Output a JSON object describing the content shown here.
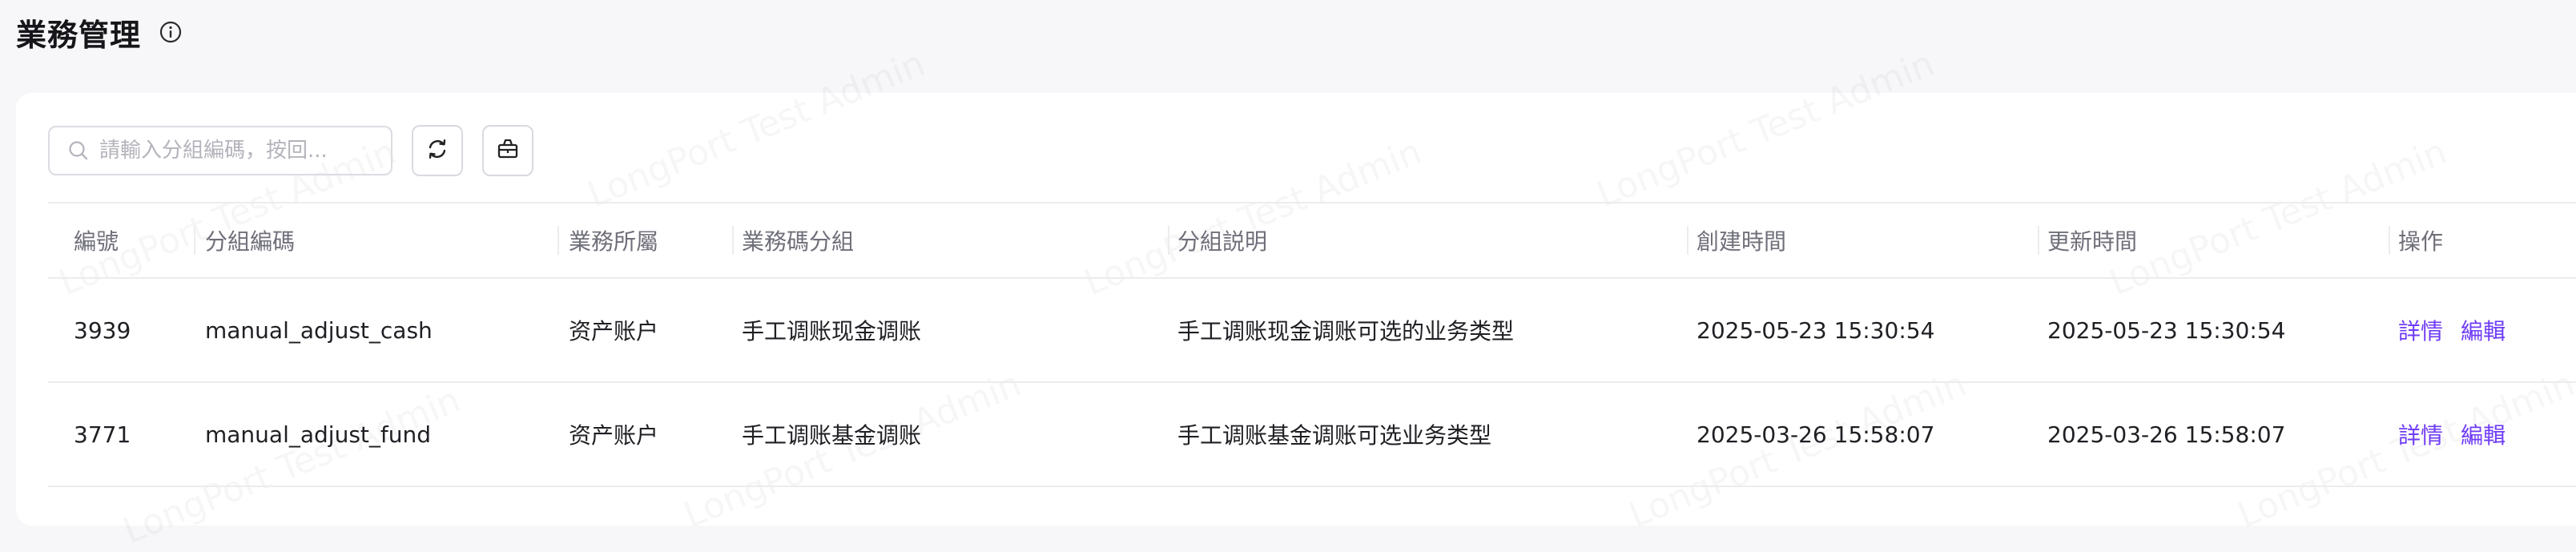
{
  "page": {
    "title": "業務管理"
  },
  "toolbar": {
    "search_placeholder": "請輸入分組編碼，按回...",
    "refresh_icon": "refresh-icon",
    "basket_icon": "basket-icon"
  },
  "table": {
    "headers": [
      "編號",
      "分組編碼",
      "業務所屬",
      "業務碼分組",
      "分組説明",
      "創建時間",
      "更新時間",
      "操作"
    ],
    "rows": [
      {
        "id": "3939",
        "code": "manual_adjust_cash",
        "owner": "资产账户",
        "group": "手工调账现金调账",
        "desc": "手工调账现金调账可选的业务类型",
        "created": "2025-05-23 15:30:54",
        "updated": "2025-05-23 15:30:54",
        "detail": "詳情",
        "edit": "編輯"
      },
      {
        "id": "3771",
        "code": "manual_adjust_fund",
        "owner": "资产账户",
        "group": "手工调账基金调账",
        "desc": "手工调账基金调账可选业务类型",
        "created": "2025-03-26 15:58:07",
        "updated": "2025-03-26 15:58:07",
        "detail": "詳情",
        "edit": "編輯"
      }
    ]
  },
  "watermark": "LongPort Test Admin",
  "colors": {
    "accent": "#6f3cf5",
    "background": "#f7f7f9",
    "card": "#ffffff"
  }
}
